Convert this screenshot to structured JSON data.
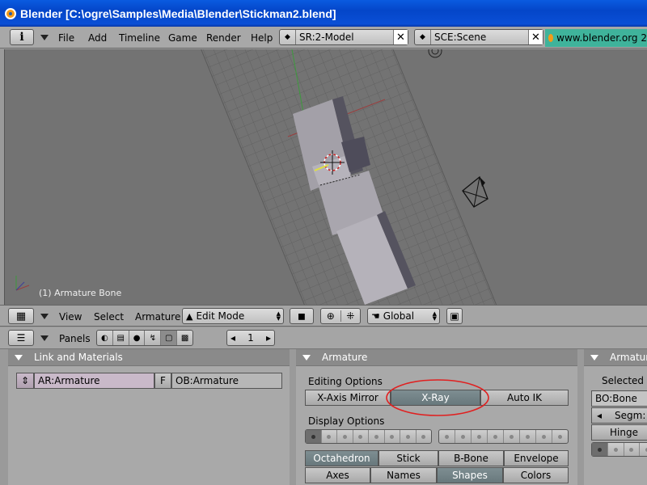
{
  "window": {
    "title": "Blender [C:\\ogre\\Samples\\Media\\Blender\\Stickman2.blend]"
  },
  "menubar": {
    "info_label": "i",
    "items": [
      "File",
      "Add",
      "Timeline",
      "Game",
      "Render",
      "Help"
    ],
    "screen_field": "SR:2-Model",
    "scene_field": "SCE:Scene",
    "url": "www.blender.org 2"
  },
  "viewport": {
    "object_label": "(1) Armature Bone"
  },
  "viewport_header": {
    "view": "View",
    "select": "Select",
    "armature": "Armature",
    "mode": "Edit Mode",
    "orientation": "Global"
  },
  "buttons_header": {
    "panels": "Panels",
    "frame": "1"
  },
  "link_panel": {
    "title": "Link and Materials",
    "armature_field": "AR:Armature",
    "fake_user": "F",
    "object_field": "OB:Armature"
  },
  "armature_panel": {
    "title": "Armature",
    "editing_options": "Editing Options",
    "x_axis_mirror": "X-Axis Mirror",
    "x_ray": "X-Ray",
    "auto_ik": "Auto IK",
    "display_options": "Display Options",
    "display_buttons": [
      "Octahedron",
      "Stick",
      "B-Bone",
      "Envelope"
    ],
    "toggle_buttons": [
      "Axes",
      "Names",
      "Shapes",
      "Colors"
    ]
  },
  "armature_bones_panel": {
    "title": "Armatur",
    "selected_label": "Selected B",
    "bone_field": "BO:Bone",
    "segm": "Segm:",
    "hinge": "Hinge"
  },
  "colors": {
    "highlight_circle": "#e02020",
    "titlebar": "#0a4fd6",
    "url_bg": "#3fb39b"
  }
}
